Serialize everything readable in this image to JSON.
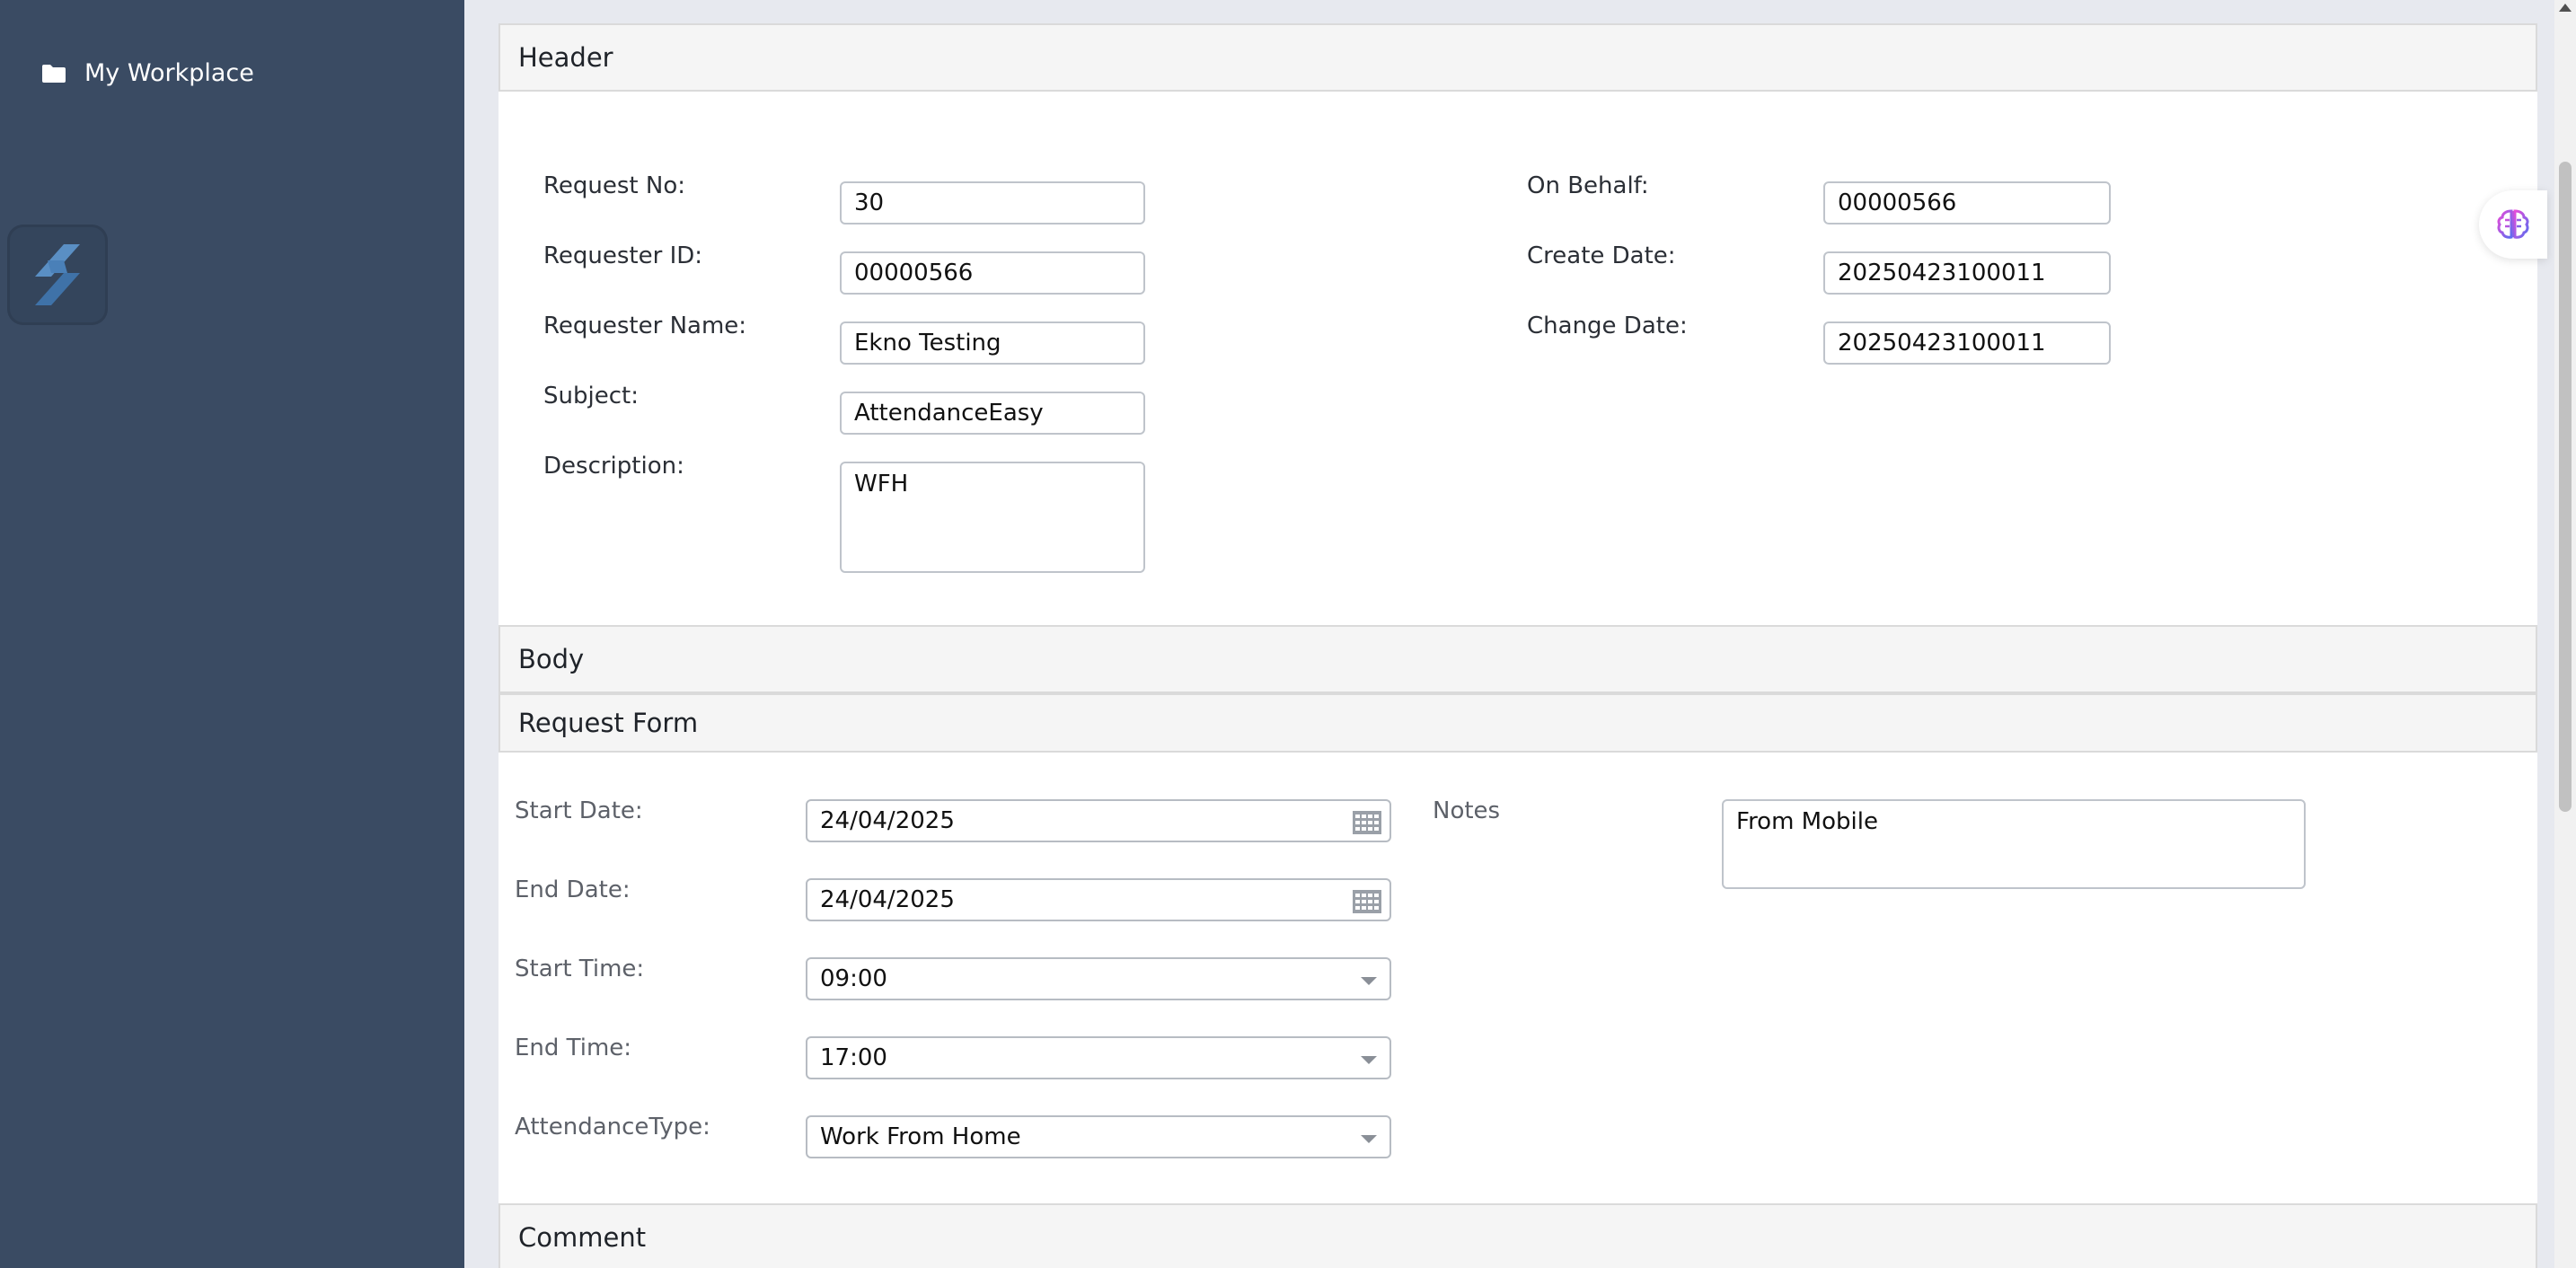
{
  "sidebar": {
    "workspace_label": "My Workplace"
  },
  "header_section": {
    "title": "Header",
    "fields": {
      "request_no": {
        "label": "Request No:",
        "value": "30"
      },
      "requester_id": {
        "label": "Requester ID:",
        "value": "00000566"
      },
      "requester_name": {
        "label": "Requester Name:",
        "value": "Ekno Testing"
      },
      "subject": {
        "label": "Subject:",
        "value": "AttendanceEasy"
      },
      "description": {
        "label": "Description:",
        "value": "WFH"
      },
      "on_behalf": {
        "label": "On Behalf:",
        "value": "00000566"
      },
      "create_date": {
        "label": "Create Date:",
        "value": "20250423100011"
      },
      "change_date": {
        "label": "Change Date:",
        "value": "20250423100011"
      }
    }
  },
  "body_section": {
    "title": "Body"
  },
  "request_form": {
    "title": "Request Form",
    "start_date": {
      "label": "Start Date:",
      "value": "24/04/2025"
    },
    "end_date": {
      "label": "End Date:",
      "value": "24/04/2025"
    },
    "start_time": {
      "label": "Start Time:",
      "value": "09:00"
    },
    "end_time": {
      "label": "End Time:",
      "value": "17:00"
    },
    "attendance_type": {
      "label": "AttendanceType:",
      "value": "Work From Home"
    },
    "notes": {
      "label": "Notes",
      "value": "From Mobile"
    }
  },
  "comment_section": {
    "title": "Comment"
  },
  "colors": {
    "sidebar_bg": "#3a4b63",
    "main_bg": "#e7e9ef",
    "section_head_bg": "#f5f5f5",
    "brain_icon_gradient": [
      "#e94bd8",
      "#5a6cf0"
    ]
  },
  "icons": {
    "workspace": "folder-icon",
    "logo": "app-logo",
    "date_picker": "calendar-grid-icon",
    "select": "chevron-down-icon",
    "assistant": "brain-icon"
  }
}
